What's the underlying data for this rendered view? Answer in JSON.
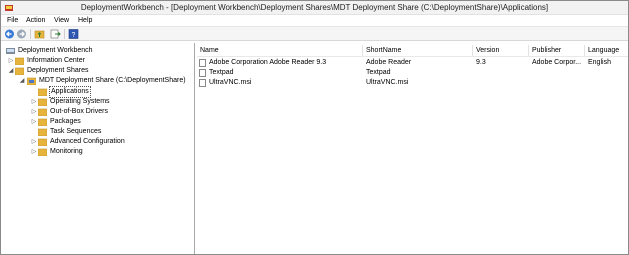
{
  "window": {
    "title": "DeploymentWorkbench - [Deployment Workbench\\Deployment Shares\\MDT Deployment Share (C:\\DeploymentShare)\\Applications]"
  },
  "menu": [
    "File",
    "Action",
    "View",
    "Help"
  ],
  "toolbar": {
    "icons": [
      "back-arrow-icon",
      "forward-arrow-icon",
      "up-folder-icon",
      "export-list-icon",
      "help-icon"
    ]
  },
  "tree": {
    "root": "Deployment Workbench",
    "information_center": "Information Center",
    "deployment_shares": "Deployment Shares",
    "share": "MDT Deployment Share (C:\\DeploymentShare)",
    "children": [
      "Applications",
      "Operating Systems",
      "Out-of-Box Drivers",
      "Packages",
      "Task Sequences",
      "Advanced Configuration",
      "Monitoring"
    ],
    "selected": "Applications"
  },
  "list": {
    "columns": [
      "Name",
      "ShortName",
      "Version",
      "Publisher",
      "Language"
    ],
    "rows": [
      [
        "Adobe Corporation Adobe Reader 9.3",
        "Adobe Reader",
        "9.3",
        "Adobe Corpor...",
        "English"
      ],
      [
        "Textpad",
        "Textpad",
        "",
        "",
        ""
      ],
      [
        "UltraVNC.msi",
        "UltraVNC.msi",
        "",
        "",
        ""
      ]
    ]
  },
  "colors": {
    "folder": "#e6b43c",
    "selection_outline": "#555555",
    "pane_border": "#a9a9a9"
  }
}
